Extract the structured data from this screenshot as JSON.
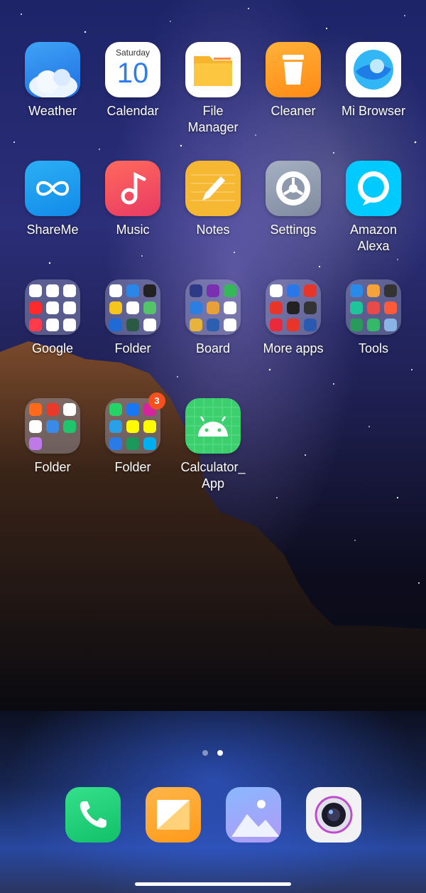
{
  "apps_row1": [
    {
      "label": "Weather",
      "icon": "cloud-icon"
    },
    {
      "label": "Calendar",
      "icon": "calendar-icon",
      "weekday": "Saturday",
      "day": "10"
    },
    {
      "label": "File\nManager",
      "icon": "folder-icon"
    },
    {
      "label": "Cleaner",
      "icon": "trash-icon"
    },
    {
      "label": "Mi Browser",
      "icon": "browser-icon"
    }
  ],
  "apps_row2": [
    {
      "label": "ShareMe",
      "icon": "infinity-icon"
    },
    {
      "label": "Music",
      "icon": "music-note-icon"
    },
    {
      "label": "Notes",
      "icon": "pencil-icon"
    },
    {
      "label": "Settings",
      "icon": "gear-icon"
    },
    {
      "label": "Amazon\nAlexa",
      "icon": "alexa-icon"
    }
  ],
  "folders_row3": [
    {
      "label": "Google"
    },
    {
      "label": "Folder"
    },
    {
      "label": "Board"
    },
    {
      "label": "More apps"
    },
    {
      "label": "Tools"
    }
  ],
  "row4": [
    {
      "label": "Folder"
    },
    {
      "label": "Folder",
      "badge": "3"
    },
    {
      "label": "Calculator_\nApp",
      "icon": "android-icon"
    }
  ],
  "dock": [
    {
      "name": "phone",
      "icon": "phone-icon"
    },
    {
      "name": "messages",
      "icon": "message-icon"
    },
    {
      "name": "gallery",
      "icon": "gallery-icon"
    },
    {
      "name": "camera",
      "icon": "camera-icon"
    }
  ],
  "page_indicator": {
    "pages": 2,
    "current": 2
  },
  "colors": {
    "label_text": "#ffffff",
    "badge": "#f4511e",
    "weather": "#2e8df0",
    "notes": "#f6b733",
    "music": "#ef4e58",
    "phone": "#1fd078",
    "calculator": "#3ccf6e"
  }
}
